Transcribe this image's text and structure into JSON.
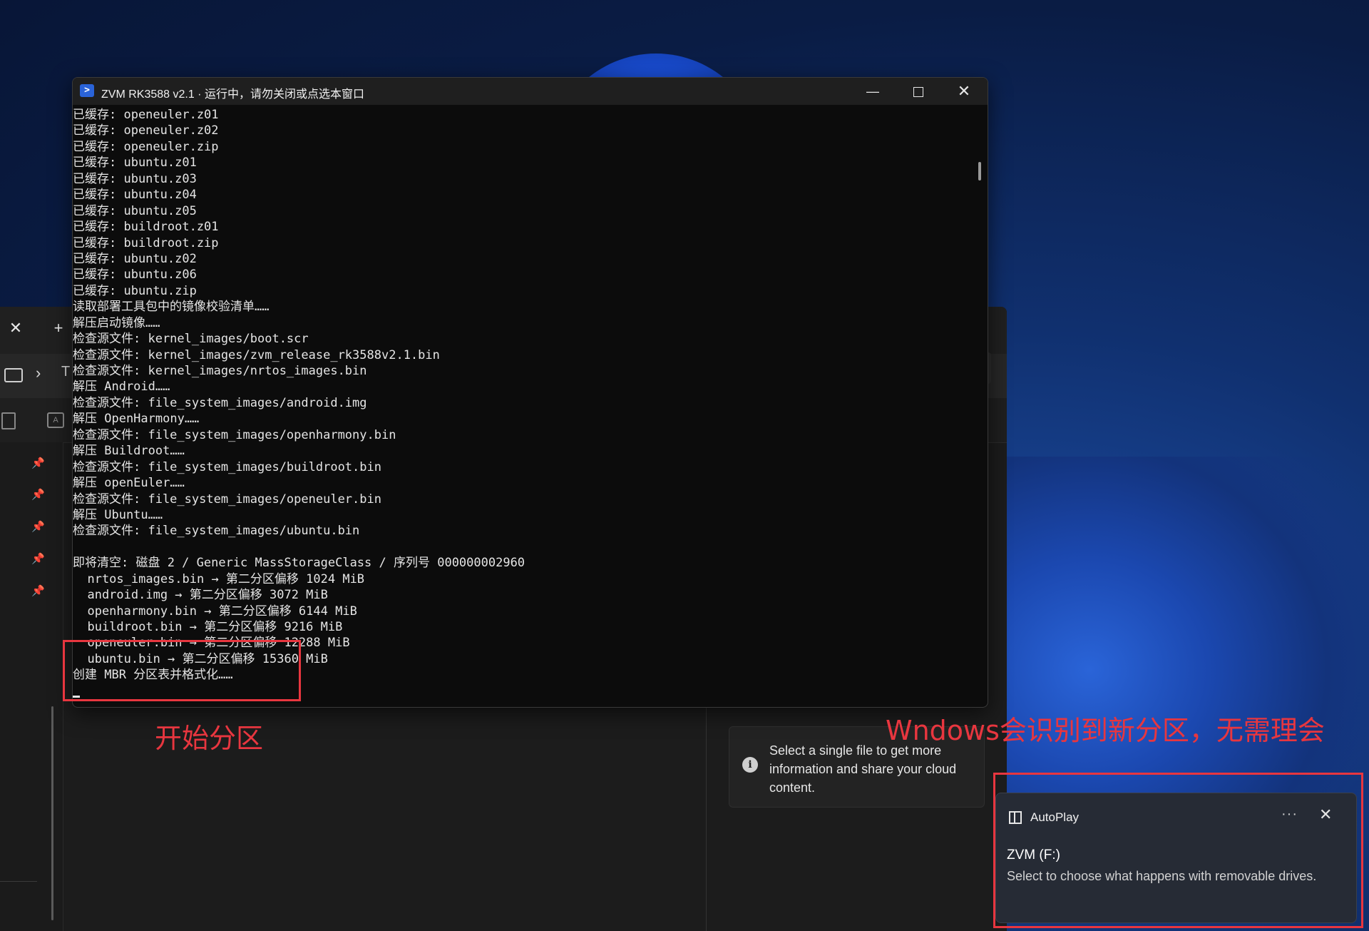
{
  "terminal": {
    "title": "ZVM RK3588 v2.1 · 运行中，请勿关闭或点选本窗口",
    "lines": [
      "已缓存: openeuler.z01",
      "已缓存: openeuler.z02",
      "已缓存: openeuler.zip",
      "已缓存: ubuntu.z01",
      "已缓存: ubuntu.z03",
      "已缓存: ubuntu.z04",
      "已缓存: ubuntu.z05",
      "已缓存: buildroot.z01",
      "已缓存: buildroot.zip",
      "已缓存: ubuntu.z02",
      "已缓存: ubuntu.z06",
      "已缓存: ubuntu.zip",
      "读取部署工具包中的镜像校验清单……",
      "解压启动镜像……",
      "检查源文件: kernel_images/boot.scr",
      "检查源文件: kernel_images/zvm_release_rk3588v2.1.bin",
      "检查源文件: kernel_images/nrtos_images.bin",
      "解压 Android……",
      "检查源文件: file_system_images/android.img",
      "解压 OpenHarmony……",
      "检查源文件: file_system_images/openharmony.bin",
      "解压 Buildroot……",
      "检查源文件: file_system_images/buildroot.bin",
      "解压 openEuler……",
      "检查源文件: file_system_images/openeuler.bin",
      "解压 Ubuntu……",
      "检查源文件: file_system_images/ubuntu.bin",
      "",
      "即将清空: 磁盘 2 / Generic MassStorageClass / 序列号 000000002960",
      "  nrtos_images.bin → 第二分区偏移 1024 MiB",
      "  android.img → 第二分区偏移 3072 MiB",
      "  openharmony.bin → 第二分区偏移 6144 MiB",
      "  buildroot.bin → 第二分区偏移 9216 MiB",
      "  openeuler.bin → 第二分区偏移 12288 MiB",
      "  ubuntu.bin → 第二分区偏移 15360 MiB",
      "创建 MBR 分区表并格式化……"
    ],
    "controls": {
      "minimize": "—",
      "close": "✕"
    },
    "icon": "powershell-icon"
  },
  "explorer": {
    "address_fragment": "T",
    "info_card_text": "Select a single file to get more information and share your cloud content.",
    "icons": [
      "close-icon",
      "plus-icon",
      "computer-icon",
      "chevron-right-icon",
      "pin-icon",
      "info-icon"
    ]
  },
  "annotations": {
    "partition_label": "开始分区",
    "windows_note": "Wndows会识别到新分区，无需理会"
  },
  "toast": {
    "app": "AutoPlay",
    "title": "ZVM (F:)",
    "body": "Select to choose what happens with removable drives.",
    "more": "···",
    "close": "✕"
  },
  "colors": {
    "annotation_red": "#e8363f",
    "terminal_bg": "#0c0c0c",
    "wallpaper_blue": "#1b48b0"
  }
}
